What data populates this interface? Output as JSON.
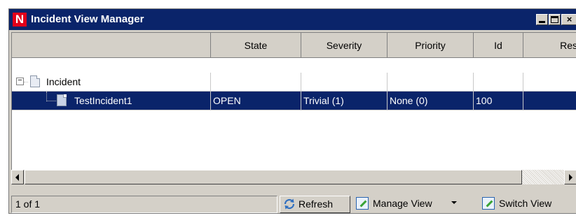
{
  "window": {
    "title": "Incident View Manager",
    "logo_letter": "N",
    "title_bar_color": "#0a246a",
    "logo_color": "#e2001a"
  },
  "table": {
    "columns": [
      "",
      "State",
      "Severity",
      "Priority",
      "Id",
      "Res"
    ],
    "rows": [
      {
        "name": "Incident",
        "state": "",
        "severity": "",
        "priority": "",
        "id": "",
        "res": "",
        "expander": "−",
        "selected": false
      },
      {
        "name": "TestIncident1",
        "state": "OPEN",
        "severity": "Trivial (1)",
        "priority": "None (0)",
        "id": "100",
        "res": "",
        "selected": true
      }
    ],
    "selection_color": "#0a246a"
  },
  "status": {
    "text": "1 of 1",
    "refresh_label": "Refresh",
    "manage_view_label": "Manage View",
    "switch_view_label": "Switch View"
  }
}
